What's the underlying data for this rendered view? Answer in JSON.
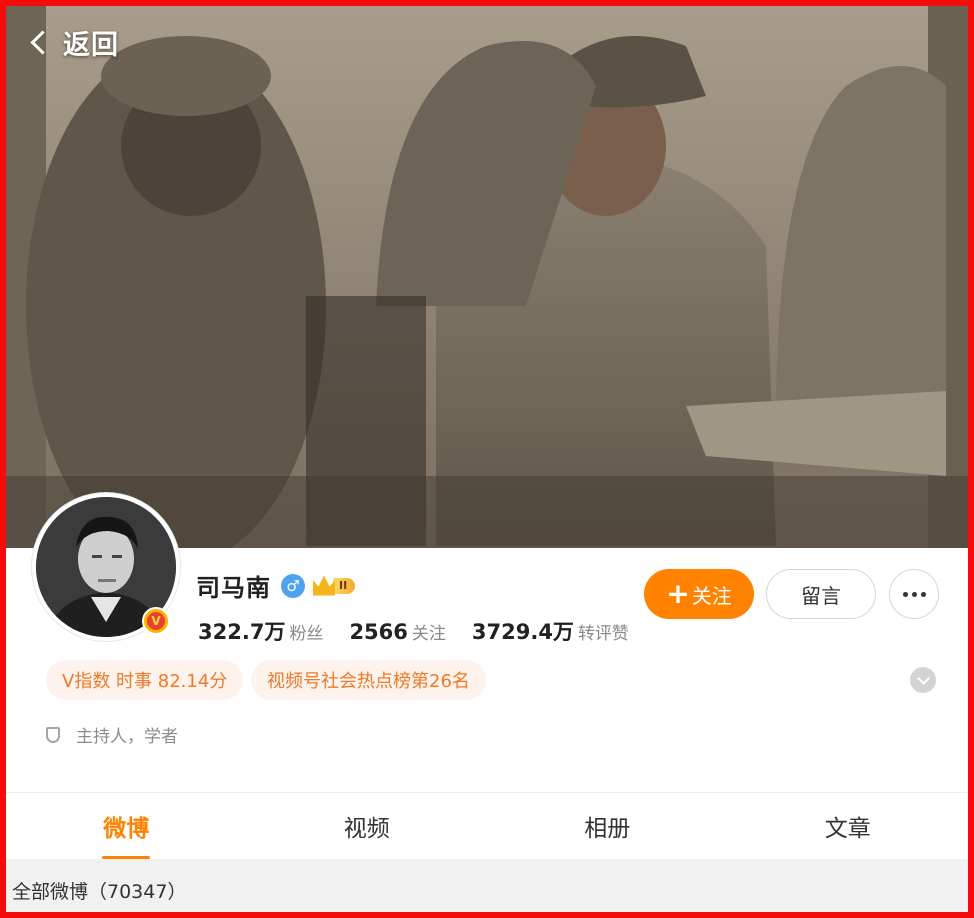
{
  "header": {
    "back_label": "返回"
  },
  "profile": {
    "name": "司马南",
    "gender_symbol": "♂",
    "verify_mark": "V",
    "vip_level": "II",
    "stats": [
      {
        "value": "322.7万",
        "label": "粉丝"
      },
      {
        "value": "2566",
        "label": "关注"
      },
      {
        "value": "3729.4万",
        "label": "转评赞"
      }
    ],
    "follow_label": "关注",
    "follow_plus": "+",
    "message_label": "留言",
    "tags": [
      "V指数 时事 82.14分",
      "视频号社会热点榜第26名"
    ],
    "description": "主持人，学者"
  },
  "tabs": [
    {
      "label": "微博",
      "active": true
    },
    {
      "label": "视频",
      "active": false
    },
    {
      "label": "相册",
      "active": false
    },
    {
      "label": "文章",
      "active": false
    }
  ],
  "feed": {
    "all_posts_label": "全部微博（70347）"
  },
  "colors": {
    "accent": "#ff8200",
    "frame": "#f50b0b",
    "tag_bg": "#fdf3ec",
    "tag_text": "#ee7a2a"
  },
  "icons": [
    "chevron-left-icon",
    "gender-male-icon",
    "vip-crown-icon",
    "verified-badge-icon",
    "more-dots-icon",
    "chevron-down-icon",
    "shield-icon"
  ]
}
